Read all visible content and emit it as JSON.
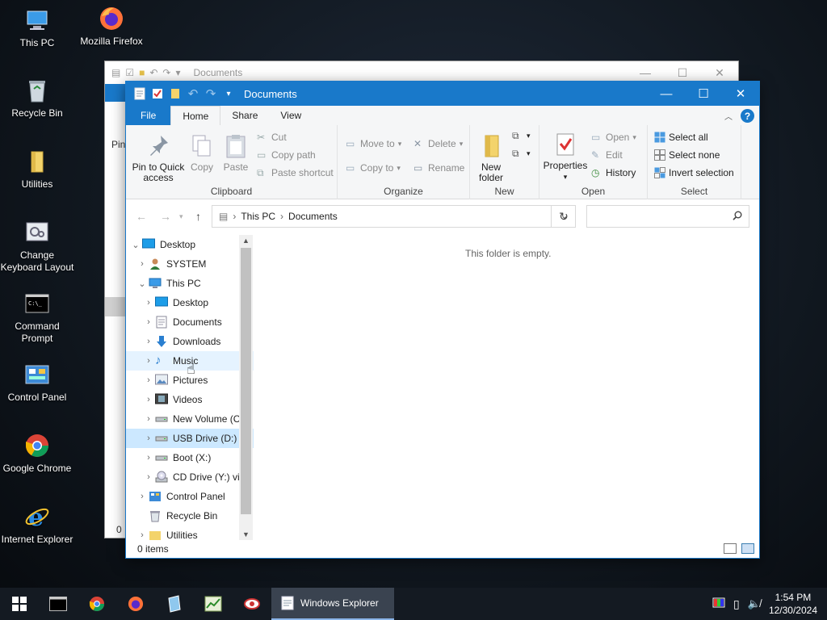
{
  "desktop": {
    "icons": [
      {
        "label": "This PC"
      },
      {
        "label": "Mozilla Firefox"
      },
      {
        "label": "Recycle Bin"
      },
      {
        "label": "Utilities"
      },
      {
        "label": "Change Keyboard Layout"
      },
      {
        "label": "Command Prompt"
      },
      {
        "label": "Control Panel"
      },
      {
        "label": "Google Chrome"
      },
      {
        "label": "Internet Explorer"
      }
    ]
  },
  "background_window": {
    "title": "Documents",
    "pin_text": "Pin",
    "status_text": "0"
  },
  "window": {
    "title": "Documents",
    "controls": {
      "minimize": "—",
      "maximize": "☐",
      "close": "✕"
    },
    "tabs": [
      "File",
      "Home",
      "Share",
      "View"
    ],
    "help_label": "?",
    "ribbon": {
      "clipboard": {
        "label": "Clipboard",
        "pin": "Pin to Quick access",
        "copy": "Copy",
        "paste": "Paste",
        "cut": "Cut",
        "copy_path": "Copy path",
        "paste_shortcut": "Paste shortcut"
      },
      "organize": {
        "label": "Organize",
        "move_to": "Move to",
        "copy_to": "Copy to",
        "delete": "Delete",
        "rename": "Rename"
      },
      "new": {
        "label": "New",
        "new_folder": "New folder"
      },
      "open": {
        "label": "Open",
        "properties": "Properties",
        "open": "Open",
        "edit": "Edit",
        "history": "History"
      },
      "select": {
        "label": "Select",
        "select_all": "Select all",
        "select_none": "Select none",
        "invert": "Invert selection"
      }
    },
    "address": {
      "crumbs": [
        "This PC",
        "Documents"
      ],
      "search_placeholder": ""
    },
    "nav_tree": [
      {
        "label": "Desktop",
        "arrow": "expanded"
      },
      {
        "label": "SYSTEM",
        "arrow": "collapsed"
      },
      {
        "label": "This PC",
        "arrow": "expanded"
      },
      {
        "label": "Desktop",
        "arrow": "collapsed"
      },
      {
        "label": "Documents",
        "arrow": "collapsed"
      },
      {
        "label": "Downloads",
        "arrow": "collapsed"
      },
      {
        "label": "Music",
        "arrow": "collapsed"
      },
      {
        "label": "Pictures",
        "arrow": "collapsed"
      },
      {
        "label": "Videos",
        "arrow": "collapsed"
      },
      {
        "label": "New Volume (C",
        "arrow": "collapsed"
      },
      {
        "label": "USB Drive (D:)",
        "arrow": "collapsed"
      },
      {
        "label": "Boot (X:)",
        "arrow": "collapsed"
      },
      {
        "label": "CD Drive (Y:) vi",
        "arrow": "collapsed"
      },
      {
        "label": "Control Panel",
        "arrow": "collapsed"
      },
      {
        "label": "Recycle Bin",
        "arrow": "none"
      },
      {
        "label": "Utilities",
        "arrow": "collapsed"
      }
    ],
    "empty_message": "This folder is empty.",
    "status": "0 items"
  },
  "taskbar": {
    "active_app": "Windows Explorer",
    "time": "1:54 PM",
    "date": "12/30/2024"
  },
  "colors": {
    "accent": "#1979ca",
    "ribbon_bg": "#f5f6f7",
    "hover_bg": "#e5f3ff",
    "selected_bg": "#cce8ff",
    "taskbar_bg": "#141a22"
  }
}
